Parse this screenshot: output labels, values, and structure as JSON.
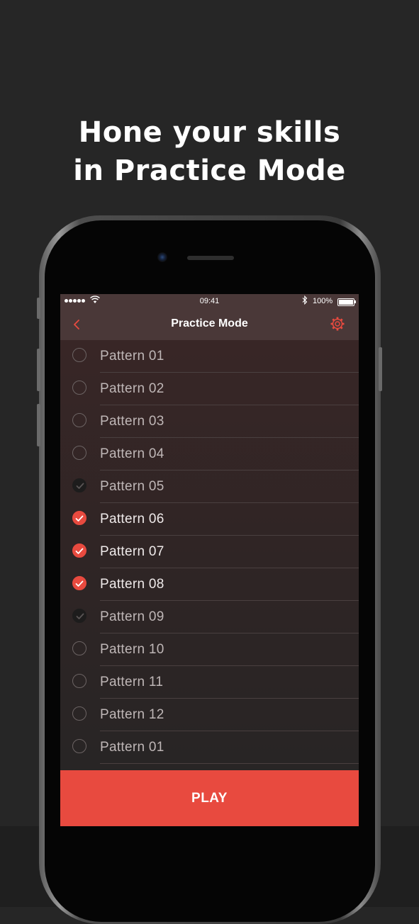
{
  "headline": {
    "line1": "Hone your skills",
    "line2": "in Practice Mode"
  },
  "status_bar": {
    "time": "09:41",
    "battery": "100%",
    "icons": [
      "signal-dots-icon",
      "wifi-icon",
      "bluetooth-icon",
      "battery-icon"
    ]
  },
  "nav": {
    "title": "Practice Mode",
    "back_icon": "chevron-left-icon",
    "settings_icon": "gear-icon"
  },
  "patterns": [
    {
      "label": "Pattern 01",
      "state": "unchecked"
    },
    {
      "label": "Pattern 02",
      "state": "unchecked"
    },
    {
      "label": "Pattern 03",
      "state": "unchecked"
    },
    {
      "label": "Pattern 04",
      "state": "unchecked"
    },
    {
      "label": "Pattern 05",
      "state": "dim-checked"
    },
    {
      "label": "Pattern 06",
      "state": "checked"
    },
    {
      "label": "Pattern 07",
      "state": "checked"
    },
    {
      "label": "Pattern 08",
      "state": "checked"
    },
    {
      "label": "Pattern 09",
      "state": "dim-checked"
    },
    {
      "label": "Pattern 10",
      "state": "unchecked"
    },
    {
      "label": "Pattern 11",
      "state": "unchecked"
    },
    {
      "label": "Pattern 12",
      "state": "unchecked"
    },
    {
      "label": "Pattern 01",
      "state": "unchecked"
    }
  ],
  "play": {
    "label": "PLAY"
  },
  "colors": {
    "accent": "#e84a3f",
    "background": "#262626",
    "navbar": "#4a3838"
  }
}
